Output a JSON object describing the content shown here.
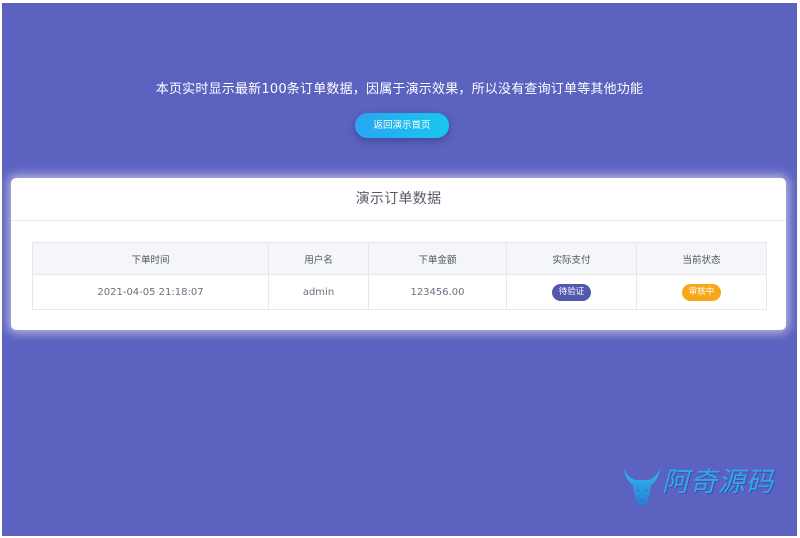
{
  "header": {
    "notice": "本页实时显示最新100条订单数据，因属于演示效果，所以没有查询订单等其他功能",
    "back_button": "返回演示首页"
  },
  "panel": {
    "title": "演示订单数据"
  },
  "table": {
    "columns": [
      "下单时间",
      "用户名",
      "下单金额",
      "实际支付",
      "当前状态"
    ],
    "rows": [
      {
        "time": "2021-04-05 21:18:07",
        "user": "admin",
        "amount": "123456.00",
        "payment": "待验证",
        "status": "审核中"
      }
    ]
  },
  "watermark": {
    "text": "阿奇源码",
    "icon": "bull-head-logo"
  },
  "colors": {
    "background": "#5c62c0",
    "button_gradient_start": "#2aa5f2",
    "button_gradient_end": "#18c8ee",
    "payment_badge": "#5258ad",
    "status_badge": "#f6a81a"
  }
}
